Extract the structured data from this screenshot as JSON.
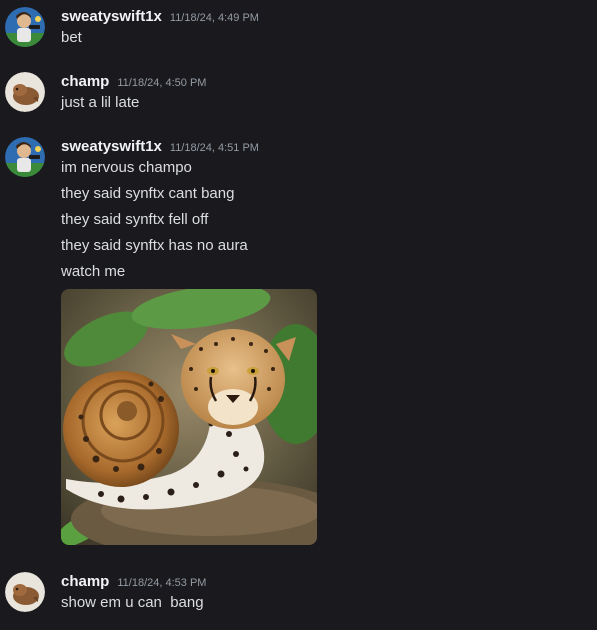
{
  "messages": [
    {
      "username": "sweatyswift1x",
      "timestamp": "11/18/24, 4:49 PM",
      "lines": [
        "bet"
      ]
    },
    {
      "username": "champ",
      "timestamp": "11/18/24, 4:50 PM",
      "lines": [
        "just a lil late"
      ]
    },
    {
      "username": "sweatyswift1x",
      "timestamp": "11/18/24, 4:51 PM",
      "lines": [
        "im nervous champo",
        "they said synftx cant bang",
        "they said synftx fell off",
        "they said synftx has no aura",
        "watch me"
      ],
      "attachment": "cheetah-snail-image"
    },
    {
      "username": "champ",
      "timestamp": "11/18/24, 4:53 PM",
      "lines": [
        "show em u can  bang"
      ]
    }
  ],
  "colors": {
    "background": "#1a1a1e",
    "username": "#f2f3f5",
    "timestamp": "#949ba4",
    "text": "#dbdee1"
  }
}
